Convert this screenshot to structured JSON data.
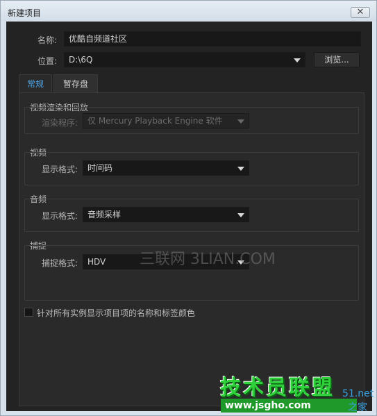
{
  "window": {
    "title": "新建项目",
    "close_label": "✕"
  },
  "project": {
    "name_label": "名称:",
    "name_value": "优酷自频道社区",
    "location_label": "位置:",
    "location_value": "D:\\6Q",
    "browse_label": "浏览..."
  },
  "tabs": [
    {
      "label": "常规",
      "active": true
    },
    {
      "label": "暂存盘",
      "active": false
    }
  ],
  "general": {
    "video_render": {
      "title": "视频渲染和回放",
      "renderer_label": "渲染程序:",
      "renderer_value": "仅 Mercury Playback Engine 软件"
    },
    "video": {
      "title": "视频",
      "display_format_label": "显示格式:",
      "display_format_value": "时间码"
    },
    "audio": {
      "title": "音频",
      "display_format_label": "显示格式:",
      "display_format_value": "音频采样"
    },
    "capture": {
      "title": "捕捉",
      "capture_format_label": "捕捉格式:",
      "capture_format_value": "HDV"
    },
    "checkbox_label": "针对所有实例显示项目项的名称和标签颜色"
  },
  "overlays": {
    "watermark_text": "三联网 3LIAN.COM",
    "brand_text": "技术员联盟",
    "brand_url": "www.jsgho.com",
    "brand_tail": "之家",
    "brand_partial": "51.net"
  }
}
